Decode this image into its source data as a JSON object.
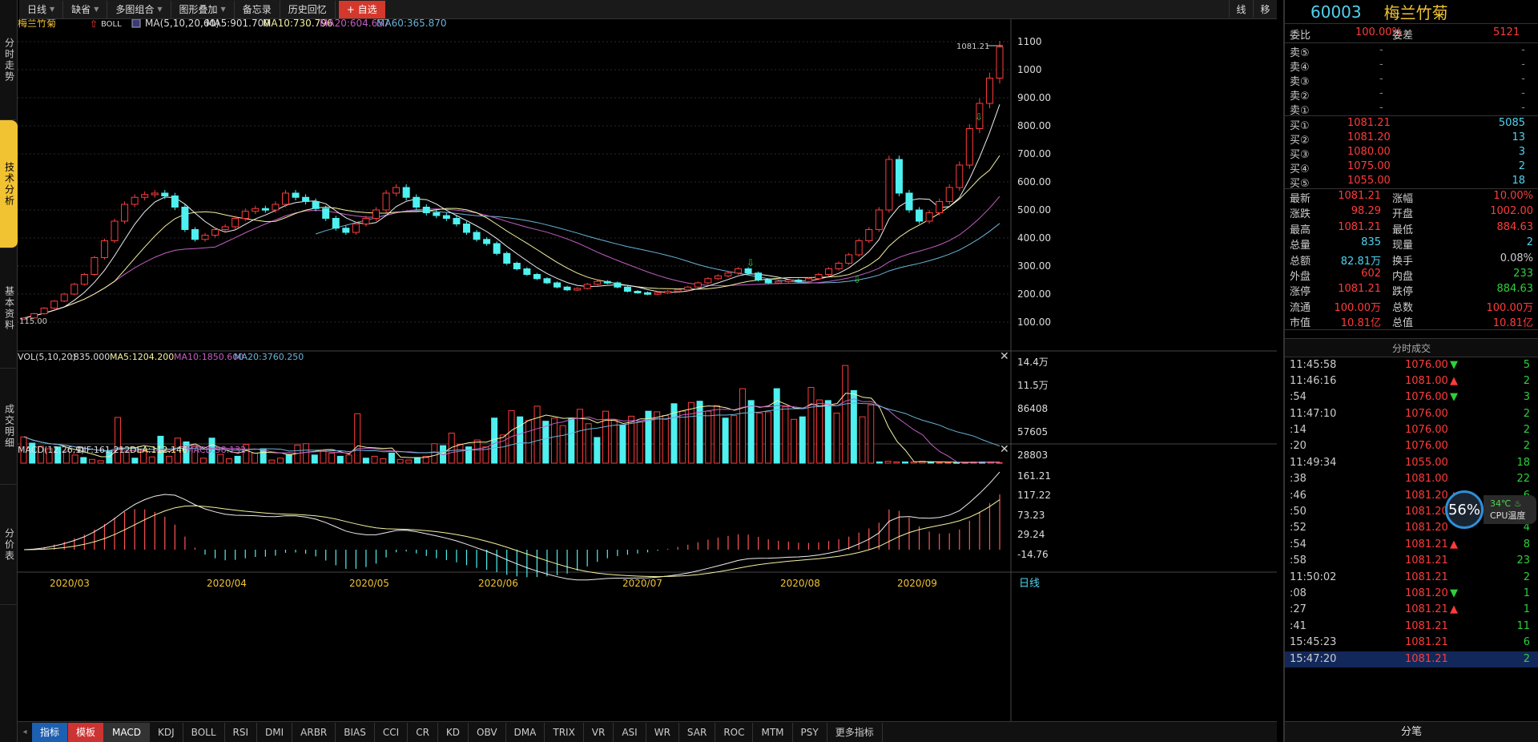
{
  "toolbar": {
    "items": [
      "日线",
      "缺省",
      "多图组合",
      "图形叠加",
      "备忘录",
      "历史回忆"
    ],
    "add_label": "+ 自选",
    "right": [
      "线",
      "移"
    ]
  },
  "left_tabs": [
    "分时走势",
    "技术分析",
    "基本资料",
    "成交明细",
    "分价表"
  ],
  "chart_header": {
    "name": "梅兰竹菊",
    "indicator": "BOLL",
    "ma_label": "MA(5,10,20,60)",
    "ma5": "MA5:901.700",
    "ma10": "MA10:730.796",
    "ma20": "MA20:604.657",
    "ma60": "MA60:365.870"
  },
  "vol_header": {
    "label": "VOL(5,10,20)",
    "value": ":835.000",
    "ma5": "MA5:1204.200",
    "ma10": "MA10:1850.600",
    "ma20": "MA20:3760.250"
  },
  "macd_header": {
    "label": "MACD(12,26,9)",
    "dif": "DIF:161.212",
    "dea": "DEA:112.146",
    "macd": "MACD:98.132"
  },
  "price_axis": [
    "1100",
    "1000",
    "900.00",
    "800.00",
    "700.00",
    "600.00",
    "500.00",
    "400.00",
    "300.00",
    "200.00",
    "100.00"
  ],
  "vol_axis": [
    "14.4万",
    "11.5万",
    "86408",
    "57605",
    "28803"
  ],
  "macd_axis": [
    "161.21",
    "117.22",
    "73.23",
    "29.24",
    "-14.76"
  ],
  "x_labels": [
    "2020/03",
    "2020/04",
    "2020/05",
    "2020/06",
    "2020/07",
    "2020/08",
    "2020/09"
  ],
  "period_label": "日线",
  "annotations": {
    "high": "1081.21",
    "low": "115.00"
  },
  "bottom_tabs": [
    "指标",
    "模板",
    "MACD",
    "KDJ",
    "BOLL",
    "RSI",
    "DMI",
    "ARBR",
    "BIAS",
    "CCI",
    "CR",
    "KD",
    "OBV",
    "DMA",
    "TRIX",
    "VR",
    "ASI",
    "WR",
    "SAR",
    "ROC",
    "MTM",
    "PSY",
    "更多指标"
  ],
  "quote": {
    "code": "60003",
    "name": "梅兰竹菊",
    "weibi_label": "委比",
    "weibi": "100.00%",
    "weicha_label": "委差",
    "weicha": "5121",
    "sell": [
      {
        "l": "卖⑤",
        "p": "-",
        "v": "-"
      },
      {
        "l": "卖④",
        "p": "-",
        "v": "-"
      },
      {
        "l": "卖③",
        "p": "-",
        "v": "-"
      },
      {
        "l": "卖②",
        "p": "-",
        "v": "-"
      },
      {
        "l": "卖①",
        "p": "-",
        "v": "-"
      }
    ],
    "buy": [
      {
        "l": "买①",
        "p": "1081.21",
        "v": "5085"
      },
      {
        "l": "买②",
        "p": "1081.20",
        "v": "13"
      },
      {
        "l": "买③",
        "p": "1080.00",
        "v": "3"
      },
      {
        "l": "买④",
        "p": "1075.00",
        "v": "2"
      },
      {
        "l": "买⑤",
        "p": "1055.00",
        "v": "18"
      }
    ],
    "stats": [
      [
        {
          "l": "最新",
          "v": "1081.21",
          "c": "rd"
        },
        {
          "l": "涨幅",
          "v": "10.00%",
          "c": "rd"
        }
      ],
      [
        {
          "l": "涨跌",
          "v": "98.29",
          "c": "rd"
        },
        {
          "l": "开盘",
          "v": "1002.00",
          "c": "rd"
        }
      ],
      [
        {
          "l": "最高",
          "v": "1081.21",
          "c": "rd"
        },
        {
          "l": "最低",
          "v": "884.63",
          "c": "rd"
        }
      ],
      [
        {
          "l": "总量",
          "v": "835",
          "c": "cy"
        },
        {
          "l": "现量",
          "v": "2",
          "c": "cy"
        }
      ],
      [
        {
          "l": "总额",
          "v": "82.81万",
          "c": "cy"
        },
        {
          "l": "换手",
          "v": "0.08%",
          "c": "w"
        }
      ],
      [
        {
          "l": "外盘",
          "v": "602",
          "c": "rd"
        },
        {
          "l": "内盘",
          "v": "233",
          "c": "gr"
        }
      ],
      [
        {
          "l": "涨停",
          "v": "1081.21",
          "c": "rd"
        },
        {
          "l": "跌停",
          "v": "884.63",
          "c": "gr"
        }
      ],
      [
        {
          "l": "流通",
          "v": "100.00万",
          "c": "rd"
        },
        {
          "l": "总数",
          "v": "100.00万",
          "c": "rd"
        }
      ],
      [
        {
          "l": "市值",
          "v": "10.81亿",
          "c": "rd"
        },
        {
          "l": "总值",
          "v": "10.81亿",
          "c": "rd"
        }
      ]
    ]
  },
  "trades_title": "分时成交",
  "trades": [
    {
      "t": "11:45:58",
      "p": "1076.00",
      "d": "▼",
      "v": "5"
    },
    {
      "t": "11:46:16",
      "p": "1081.00",
      "d": "▲",
      "v": "2"
    },
    {
      "t": ":54",
      "p": "1076.00",
      "d": "▼",
      "v": "3"
    },
    {
      "t": "11:47:10",
      "p": "1076.00",
      "d": "",
      "v": "2"
    },
    {
      "t": ":14",
      "p": "1076.00",
      "d": "",
      "v": "2"
    },
    {
      "t": ":20",
      "p": "1076.00",
      "d": "",
      "v": "2"
    },
    {
      "t": "11:49:34",
      "p": "1055.00",
      "d": "",
      "v": "18"
    },
    {
      "t": ":38",
      "p": "1081.00",
      "d": "",
      "v": "22"
    },
    {
      "t": ":46",
      "p": "1081.20",
      "d": "▲",
      "v": "6"
    },
    {
      "t": ":50",
      "p": "1081.20",
      "d": "",
      "v": "9"
    },
    {
      "t": ":52",
      "p": "1081.20",
      "d": "",
      "v": "4"
    },
    {
      "t": ":54",
      "p": "1081.21",
      "d": "▲",
      "v": "8"
    },
    {
      "t": ":58",
      "p": "1081.21",
      "d": "",
      "v": "23"
    },
    {
      "t": "11:50:02",
      "p": "1081.21",
      "d": "",
      "v": "2"
    },
    {
      "t": ":08",
      "p": "1081.20",
      "d": "▼",
      "v": "1"
    },
    {
      "t": ":27",
      "p": "1081.21",
      "d": "▲",
      "v": "1"
    },
    {
      "t": ":41",
      "p": "1081.21",
      "d": "",
      "v": "11"
    },
    {
      "t": "15:45:23",
      "p": "1081.21",
      "d": "",
      "v": "6"
    },
    {
      "t": "15:47:20",
      "p": "1081.21",
      "d": "",
      "v": "2"
    }
  ],
  "trades_footer": "分笔",
  "cpu": {
    "usage": "56%",
    "temp": "34℃",
    "label": "CPU温度"
  },
  "chart_data": {
    "type": "candlestick",
    "x": [
      "2020/03",
      "2020/04",
      "2020/05",
      "2020/06",
      "2020/07",
      "2020/08",
      "2020/09"
    ],
    "close_path": [
      115,
      130,
      150,
      175,
      200,
      235,
      270,
      330,
      390,
      460,
      520,
      545,
      555,
      560,
      550,
      510,
      430,
      395,
      410,
      430,
      440,
      470,
      495,
      505,
      500,
      520,
      560,
      545,
      530,
      505,
      470,
      435,
      420,
      450,
      470,
      500,
      560,
      580,
      545,
      510,
      490,
      480,
      470,
      450,
      420,
      395,
      380,
      345,
      310,
      290,
      270,
      255,
      240,
      225,
      215,
      220,
      235,
      245,
      240,
      225,
      210,
      205,
      200,
      205,
      210,
      215,
      225,
      240,
      255,
      265,
      275,
      290,
      275,
      250,
      240,
      245,
      250,
      245,
      255,
      270,
      290,
      310,
      340,
      390,
      430,
      500,
      680,
      560,
      500,
      460,
      490,
      530,
      580,
      660,
      790,
      880,
      970,
      1081
    ],
    "vol_values": [
      4.2,
      3.2,
      2.7,
      2.3,
      2.6,
      1.9,
      1.3,
      0.9,
      0.6,
      0.4,
      2.0,
      7.3,
      1.8,
      0.8,
      2.1,
      1.0,
      4.3,
      1.1,
      4.0,
      3.4,
      2.6,
      0.8,
      4.0,
      1.4,
      0.7,
      1.1,
      3.0,
      1.6,
      2.3,
      0.5,
      0.8,
      1.4,
      2.9,
      3.1,
      1.3,
      2.0,
      1.6,
      1.1,
      1.3,
      7.9,
      0.8,
      1.1,
      0.7,
      1.6,
      0.6,
      0.5,
      0.9,
      1.1,
      3.1,
      2.8,
      4.8,
      3.0,
      2.6,
      3.7,
      2.6,
      7.2,
      4.5,
      8.4,
      7.4,
      6.8,
      9.1,
      6.7,
      7.2,
      6.0,
      7.1,
      8.6,
      6.3,
      4.1,
      8.3,
      6.9,
      6.1,
      7.5,
      6.6,
      8.3,
      8.2,
      7.6,
      9.5,
      8.3,
      9.7,
      9.9,
      8.3,
      9.2,
      7.2,
      7.6,
      11.9,
      10.0,
      8.0,
      8.2,
      11.9,
      9.0,
      7.0,
      7.4,
      12.1,
      10.1,
      10.0,
      8.0,
      15.6,
      11.6,
      7.4,
      9.3,
      0.2,
      0.3,
      0.2,
      0.2,
      0.2,
      0.3,
      0.2,
      0.1,
      0.1,
      0.1,
      0.1,
      0.2,
      0.2,
      0.2,
      0.1
    ]
  }
}
